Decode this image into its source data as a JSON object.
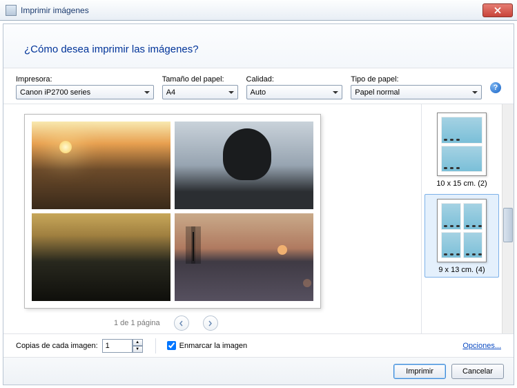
{
  "titlebar": {
    "title": "Imprimir imágenes"
  },
  "header": {
    "question": "¿Cómo desea imprimir las imágenes?"
  },
  "fields": {
    "printer": {
      "label": "Impresora:",
      "value": "Canon iP2700 series"
    },
    "paperSize": {
      "label": "Tamaño del papel:",
      "value": "A4"
    },
    "quality": {
      "label": "Calidad:",
      "value": "Auto"
    },
    "paperType": {
      "label": "Tipo de papel:",
      "value": "Papel normal"
    }
  },
  "pager": {
    "text": "1 de 1 página"
  },
  "layouts": {
    "option1": "10 x 15 cm. (2)",
    "option2": "9 x 13 cm. (4)"
  },
  "options": {
    "copiesLabel": "Copias de cada imagen:",
    "copiesValue": "1",
    "frameLabel": "Enmarcar la imagen",
    "optionsLink": "Opciones..."
  },
  "buttons": {
    "print": "Imprimir",
    "cancel": "Cancelar"
  }
}
